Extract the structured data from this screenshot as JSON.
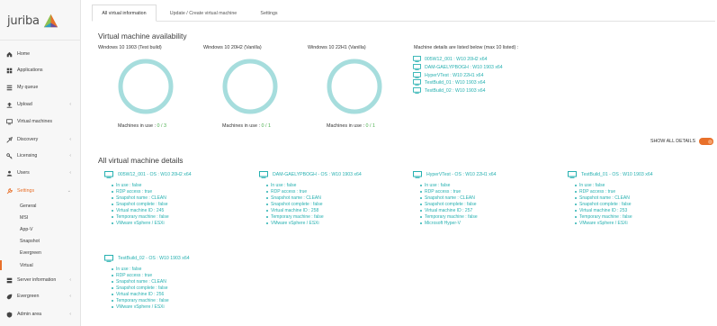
{
  "brand": {
    "name": "juriba",
    "accent": "#e8702a",
    "link_color": "#26b0b0"
  },
  "sidebar": {
    "items": [
      {
        "label": "Home",
        "icon": "home-icon",
        "has_chevron": false
      },
      {
        "label": "Applications",
        "icon": "applications-icon",
        "has_chevron": false
      },
      {
        "label": "My queue",
        "icon": "queue-icon",
        "has_chevron": false
      },
      {
        "label": "Upload",
        "icon": "upload-icon",
        "has_chevron": true
      },
      {
        "label": "Virtual machines",
        "icon": "monitor-icon",
        "has_chevron": false
      },
      {
        "label": "Discovery",
        "icon": "discovery-icon",
        "has_chevron": true
      },
      {
        "label": "Licensing",
        "icon": "key-icon",
        "has_chevron": true
      },
      {
        "label": "Users",
        "icon": "users-icon",
        "has_chevron": true
      },
      {
        "label": "Settings",
        "icon": "wrench-icon",
        "has_chevron": true,
        "active": true
      }
    ],
    "sub_items": [
      "General",
      "MSI",
      "App-V",
      "Snapshot",
      "Evergreen",
      "Virtual"
    ],
    "bottom_items": [
      {
        "label": "Server information",
        "icon": "server-icon",
        "has_chevron": true
      },
      {
        "label": "Evergreen",
        "icon": "evergreen-icon",
        "has_chevron": true
      },
      {
        "label": "Admin area",
        "icon": "admin-icon",
        "has_chevron": true
      }
    ]
  },
  "tabs": [
    "All virtual information",
    "Update / Create virtual machine",
    "Settings"
  ],
  "availability": {
    "heading": "Virtual machine availability",
    "machines": [
      {
        "name": "Windows 10 1903 (Test build)",
        "inuse_label": "Machines in use :",
        "inuse": "0 / 3",
        "used": 0,
        "total": 3
      },
      {
        "name": "Windows 10 20H2 (Vanilla)",
        "inuse_label": "Machines in use :",
        "inuse": "0 / 1",
        "used": 0,
        "total": 1
      },
      {
        "name": "Windows 10 22H1 (Vanilla)",
        "inuse_label": "Machines in use :",
        "inuse": "0 / 1",
        "used": 0,
        "total": 1
      }
    ],
    "details_label": "Machine details are listed below (max 10 listed) :",
    "listed": [
      "005W12_001 : W10 20H2 x64",
      "DAM-GAELYPBOGH : W10 1903 x64",
      "HyperVTest : W10 22H1 x64",
      "TestBuild_01 : W10 1903 x64",
      "TestBuild_02 : W10 1903 x64"
    ]
  },
  "toggle": {
    "label": "SHOW ALL DETAILS",
    "on": true
  },
  "details": {
    "heading": "All virtual machine details",
    "cards": [
      {
        "title": "005W12_001 - OS : W10 20H2 x64",
        "props": [
          "In use : false",
          "RDP access : true",
          "Snapshot name : CLEAN",
          "Snapshot complete : false",
          "Virtual machine ID : 245",
          "Temporary machine : false",
          "VMware vSphere / ESXi"
        ]
      },
      {
        "title": "DAM-GAELYPBOGH - OS : W10 1903 x64",
        "props": [
          "In use : false",
          "RDP access : true",
          "Snapshot name : CLEAN",
          "Snapshot complete : false",
          "Virtual machine ID : 258",
          "Temporary machine : false",
          "VMware vSphere / ESXi"
        ]
      },
      {
        "title": "HyperVTest - OS : W10 22H1 x64",
        "props": [
          "In use : false",
          "RDP access : true",
          "Snapshot name : CLEAN",
          "Snapshot complete : false",
          "Virtual machine ID : 257",
          "Temporary machine : false",
          "Microsoft Hyper-V"
        ]
      },
      {
        "title": "TestBuild_01 - OS : W10 1903 x64",
        "props": [
          "In use : false",
          "RDP access : true",
          "Snapshot name : CLEAN",
          "Snapshot complete : false",
          "Virtual machine ID : 253",
          "Temporary machine : false",
          "VMware vSphere / ESXi"
        ]
      },
      {
        "title": "TestBuild_02 - OS : W10 1903 x64",
        "props": [
          "In use : false",
          "RDP access : true",
          "Snapshot name : CLEAN",
          "Snapshot complete : false",
          "Virtual machine ID : 256",
          "Temporary machine : false",
          "VMware vSphere / ESXi"
        ]
      }
    ]
  }
}
